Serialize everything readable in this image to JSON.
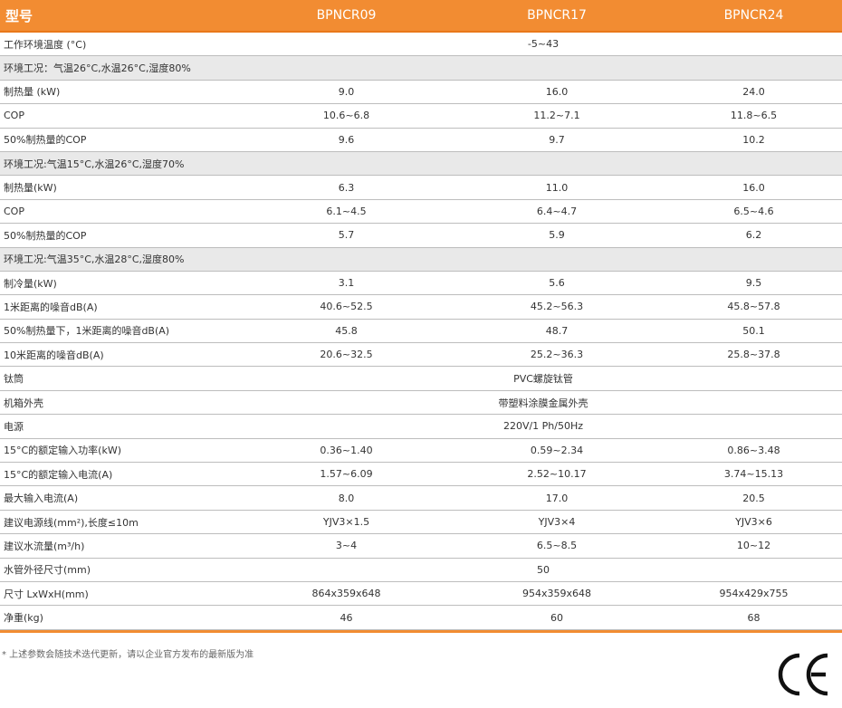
{
  "header": {
    "col0": "型号",
    "col1": "BPNCR09",
    "col2": "BPNCR17",
    "col3": "BPNCR24"
  },
  "rows": [
    {
      "type": "span",
      "label": "工作环境温度 (°C)",
      "value": "-5~43"
    },
    {
      "type": "section",
      "label": "环境工况：气温26°C,水温26°C,湿度80%"
    },
    {
      "type": "data",
      "label": "制热量 (kW)",
      "v1": "9.0",
      "v2": "16.0",
      "v3": "24.0"
    },
    {
      "type": "data",
      "label": "COP",
      "v1": "10.6~6.8",
      "v2": "11.2~7.1",
      "v3": "11.8~6.5"
    },
    {
      "type": "data",
      "label": "50%制热量的COP",
      "v1": "9.6",
      "v2": "9.7",
      "v3": "10.2"
    },
    {
      "type": "section",
      "label": "环境工况:气温15°C,水温26°C,湿度70%"
    },
    {
      "type": "data",
      "label": "制热量(kW)",
      "v1": "6.3",
      "v2": "11.0",
      "v3": "16.0"
    },
    {
      "type": "data",
      "label": "COP",
      "v1": "6.1~4.5",
      "v2": "6.4~4.7",
      "v3": "6.5~4.6"
    },
    {
      "type": "data",
      "label": "50%制热量的COP",
      "v1": "5.7",
      "v2": "5.9",
      "v3": "6.2"
    },
    {
      "type": "section",
      "label": "环境工况:气温35°C,水温28°C,湿度80%"
    },
    {
      "type": "data",
      "label": "制冷量(kW)",
      "v1": "3.1",
      "v2": "5.6",
      "v3": "9.5"
    },
    {
      "type": "data",
      "label": "1米距离的噪音dB(A)",
      "v1": "40.6~52.5",
      "v2": "45.2~56.3",
      "v3": "45.8~57.8"
    },
    {
      "type": "data",
      "label": "50%制热量下，1米距离的噪音dB(A)",
      "v1": "45.8",
      "v2": "48.7",
      "v3": "50.1"
    },
    {
      "type": "data",
      "label": "10米距离的噪音dB(A)",
      "v1": "20.6~32.5",
      "v2": "25.2~36.3",
      "v3": "25.8~37.8"
    },
    {
      "type": "span",
      "label": "钛筒",
      "value": "PVC螺旋钛管"
    },
    {
      "type": "span",
      "label": "机箱外壳",
      "value": "带塑料涂膜金属外壳"
    },
    {
      "type": "span",
      "label": "电源",
      "value": "220V/1 Ph/50Hz"
    },
    {
      "type": "data",
      "label": "15°C的额定输入功率(kW)",
      "v1": "0.36~1.40",
      "v2": "0.59~2.34",
      "v3": "0.86~3.48"
    },
    {
      "type": "data",
      "label": "15°C的额定输入电流(A)",
      "v1": "1.57~6.09",
      "v2": "2.52~10.17",
      "v3": "3.74~15.13"
    },
    {
      "type": "data",
      "label": "最大输入电流(A)",
      "v1": "8.0",
      "v2": "17.0",
      "v3": "20.5"
    },
    {
      "type": "data",
      "label": "建议电源线(mm²),长度≤10m",
      "v1": "YJV3×1.5",
      "v2": "YJV3×4",
      "v3": "YJV3×6"
    },
    {
      "type": "data",
      "label": "建议水流量(m³/h)",
      "v1": "3~4",
      "v2": "6.5~8.5",
      "v3": "10~12"
    },
    {
      "type": "span",
      "label": "水管外径尺寸(mm)",
      "value": "50"
    },
    {
      "type": "data",
      "label": "尺寸 LxWxH(mm)",
      "v1": "864x359x648",
      "v2": "954x359x648",
      "v3": "954x429x755"
    },
    {
      "type": "data",
      "label": "净重(kg)",
      "v1": "46",
      "v2": "60",
      "v3": "68"
    }
  ],
  "footnote": "* 上述参数会随技术迭代更新，请以企业官方发布的最新版为准",
  "colors": {
    "accent": "#f28c32",
    "section_bg": "#e9e9e9",
    "border": "#bdbdbd"
  },
  "logo": "ce-mark-icon"
}
